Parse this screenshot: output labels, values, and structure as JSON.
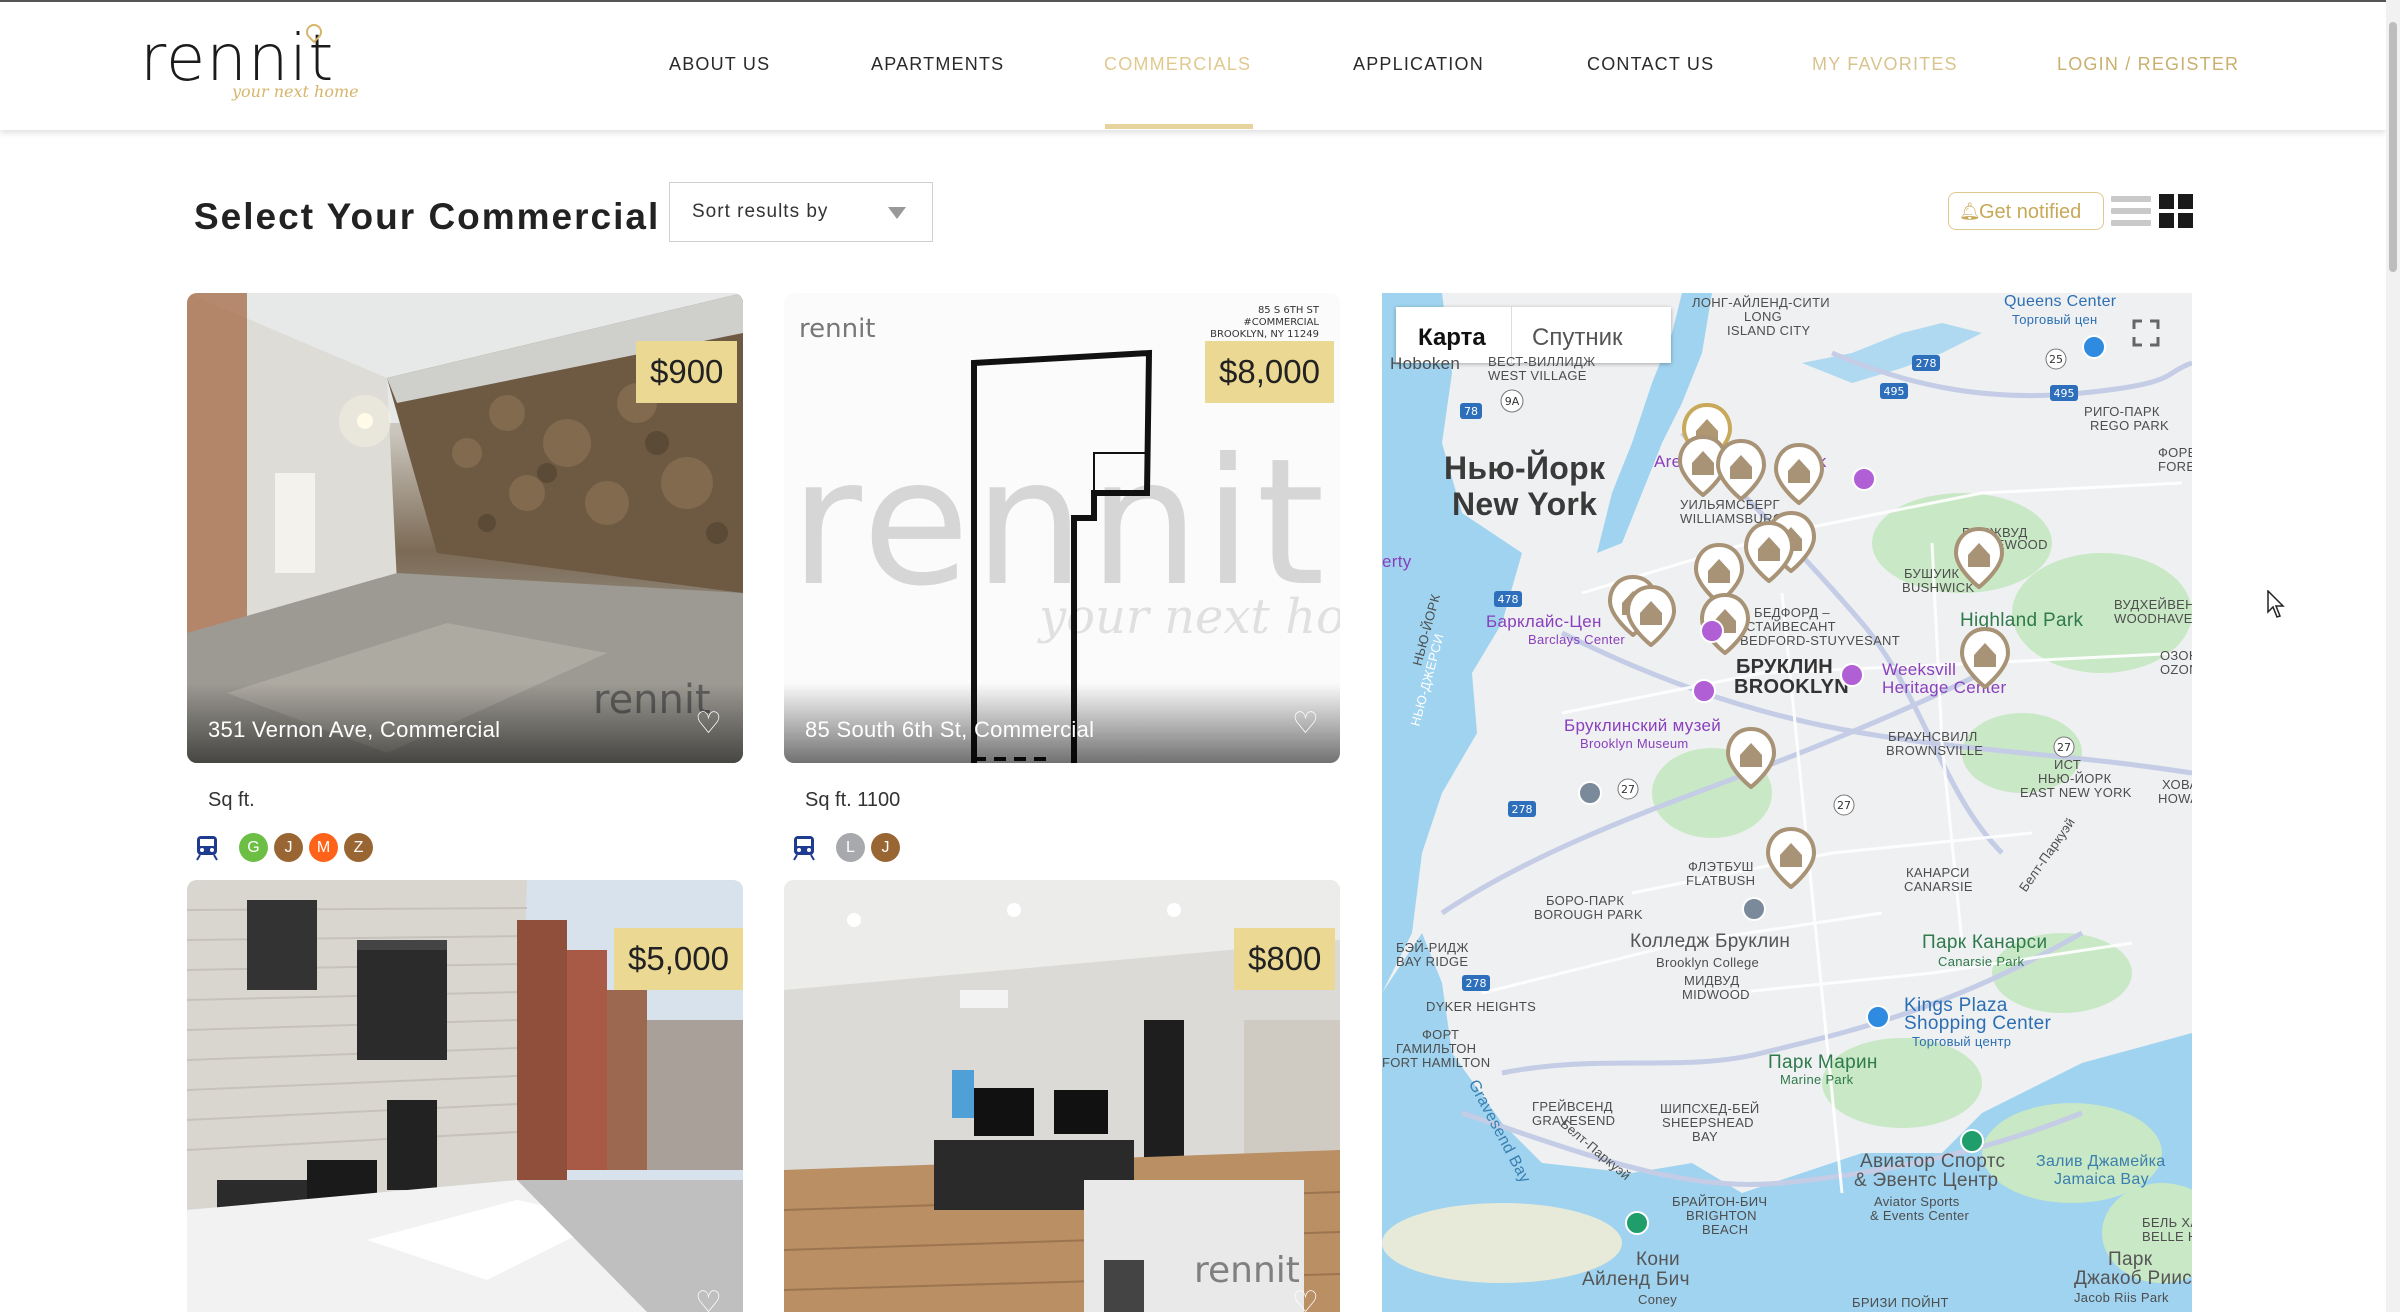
{
  "header": {
    "logo": {
      "word": "rennit",
      "tagline": "your next home"
    },
    "nav": [
      {
        "label": "ABOUT US",
        "state": "default"
      },
      {
        "label": "APARTMENTS",
        "state": "default"
      },
      {
        "label": "COMMERCIALS",
        "state": "active"
      },
      {
        "label": "APPLICATION",
        "state": "default"
      },
      {
        "label": "CONTACT US",
        "state": "default"
      },
      {
        "label": "MY FAVORITES",
        "state": "muted"
      },
      {
        "label": "LOGIN / REGISTER",
        "state": "login"
      }
    ]
  },
  "toolbar": {
    "title": "Select Your Commercial",
    "sort_placeholder": "Sort results by",
    "notify_label": "Get notified",
    "view_mode": "grid"
  },
  "listings": [
    {
      "price": "$900",
      "title": "351 Vernon Ave, Commercial",
      "sqft": "Sq ft.",
      "photo": "basement-stone-wall",
      "watermark": "rennit",
      "lines": [
        {
          "label": "G",
          "color": "#6cbe45"
        },
        {
          "label": "J",
          "color": "#996633"
        },
        {
          "label": "M",
          "color": "#ff6319"
        },
        {
          "label": "Z",
          "color": "#996633"
        }
      ]
    },
    {
      "price": "$8,000",
      "title": "85 South 6th St, Commercial",
      "sqft": "Sq ft. 1100",
      "photo": "floor-plan",
      "watermark": "rennit",
      "watermark_tagline": "your next home",
      "plan_note": [
        "85 S 6TH ST",
        "#COMMERCIAL",
        "BROOKLYN, NY 11249"
      ],
      "lines": [
        {
          "label": "L",
          "color": "#a7a9ac"
        },
        {
          "label": "J",
          "color": "#996633"
        }
      ]
    },
    {
      "price": "$5,000",
      "title": "",
      "photo": "townhouse-street-snow",
      "lines": []
    },
    {
      "price": "$800",
      "title": "",
      "photo": "office-interior",
      "watermark": "rennit",
      "lines": []
    }
  ],
  "map": {
    "tabs": [
      {
        "label": "Карта",
        "selected": true
      },
      {
        "label": "Спутник",
        "selected": false
      }
    ],
    "labels": {
      "queens_center": "Queens Center",
      "queens_center_sub": "Торговый цен",
      "long_island_city": "ЛОНГ-АЙЛЕНД-СИТИ",
      "long_island_city2": "LONG",
      "long_island_city3": "ISLAND CITY",
      "hoboken": "Hoboken",
      "west_village_ru": "ВЕСТ-ВИЛЛИДЖ",
      "west_village": "WEST VILLAGE",
      "rego_park_ru": "РИГО-ПАРК",
      "rego_park": "REGO PARK",
      "forest_ru": "ФОРЕС",
      "forest": "FORES",
      "ny_ru": "Нью-Йорк",
      "ny": "New York",
      "area": "Area",
      "ark": "ark",
      "williamsburg_ru": "УИЛЬЯМСБЕРГ",
      "williamsburg": "WILLIAMSBURG",
      "ridgewood_ru": "РИДЖВУД",
      "ridgewood": "RIDGEWOOD",
      "bushwick_ru": "БУШУИК",
      "bushwick": "BUSHWICK",
      "woodhaven_ru": "ВУДХЕЙВЕН",
      "woodhaven": "WOODHAVEN",
      "liberty": "erty",
      "barclays_ru": "Барклайс-Цен",
      "barclays": "Barclays Center",
      "bedstuy_ru": "БЕДФОРД –",
      "bedstuy_ru2": "СТАЙВЕСАНТ",
      "bedstuy": "BEDFORD-STUYVESANT",
      "highland_park": "Highland Park",
      "ozone_ru": "ОЗОН",
      "ozone": "OZONE",
      "jersey_ru": "НЬЮ-ДЖЕРСИ",
      "new_york_vert": "НЬЮ-ЙОРК",
      "brooklyn_ru": "БРУКЛИН",
      "brooklyn": "BROOKLYN",
      "weeksville_ru": "Weeksvill",
      "weeksville": "Heritage Center",
      "brooklyn_museum_ru": "Бруклинский музей",
      "brooklyn_museum": "Brooklyn Museum",
      "brownsville_ru": "БРАУНСВИЛЛ",
      "brownsville": "BROWNSVILLE",
      "east_ny_ru": "ИСТ",
      "east_ny_ru2": "НЬЮ-ЙОРК",
      "east_ny": "EAST NEW YORK",
      "howard_ru": "ХОВА",
      "howard": "HOWAR",
      "flatbush_ru": "ФЛЭТБУШ",
      "flatbush": "FLATBUSH",
      "canarsie_ru": "КАНАРСИ",
      "canarsie": "CANARSIE",
      "borough_park_ru": "БОРО-ПАРК",
      "borough_park": "BOROUGH PARK",
      "brooklyn_college_ru": "Колледж Бруклин",
      "brooklyn_college": "Brooklyn College",
      "midwood_ru": "МИДВУД",
      "midwood": "MIDWOOD",
      "canarsie_park_ru": "Парк Канарси",
      "canarsie_park": "Canarsie Park",
      "bay_ridge_ru": "БЭЙ-РИДЖ",
      "bay_ridge": "BAY RIDGE",
      "dyker_heights": "DYKER HEIGHTS",
      "fort_hamilton_ru": "ФОРТ",
      "fort_hamilton_ru2": "ГАМИЛЬТОН",
      "fort_hamilton": "FORT HAMILTON",
      "kings_plaza": "Kings Plaza",
      "kings_plaza2": "Shopping Center",
      "kings_plaza_sub": "Торговый центр",
      "marine_park_ru": "Парк Марин",
      "marine_park": "Marine Park",
      "gravesend_ru": "ГРЕЙВСЕНД",
      "gravesend": "GRAVESEND",
      "sheepshead_ru": "ШИПСХЕД-БЕЙ",
      "sheepshead": "SHEEPSHEAD",
      "sheepshead2": "BAY",
      "aviator_ru": "Авиатор Спортс",
      "aviator_ru2": "& Эвентс Центр",
      "aviator": "Aviator Sports",
      "aviator2": "& Events Center",
      "jamaica_bay_ru": "Залив Джамейка",
      "jamaica_bay": "Jamaica Bay",
      "gravesend_bay": "Gravesend Bay",
      "belt_parkway": "Белт-Паркуэй",
      "belt_parkway2": "Белт-Паркуэй",
      "belle_harbor_ru": "БЕЛЬ ХАР",
      "belle_harbor": "BELLE HAR",
      "brighton_ru": "БРАЙТОН-БИЧ",
      "brighton": "BRIGHTON",
      "brighton2": "BEACH",
      "coney_ru": "Кони",
      "coney_ru2": "Айленд Бич",
      "coney": "Coney",
      "riis_ru": "Парк",
      "riis_ru2": "Джакоб Риис",
      "riis": "Jacob Riis Park",
      "breezy_ru": "БРИЗИ ПОЙНТ"
    },
    "route_shields": [
      "278",
      "495",
      "25",
      "495",
      "9A",
      "78",
      "478",
      "278",
      "27",
      "27",
      "27",
      "278"
    ]
  }
}
